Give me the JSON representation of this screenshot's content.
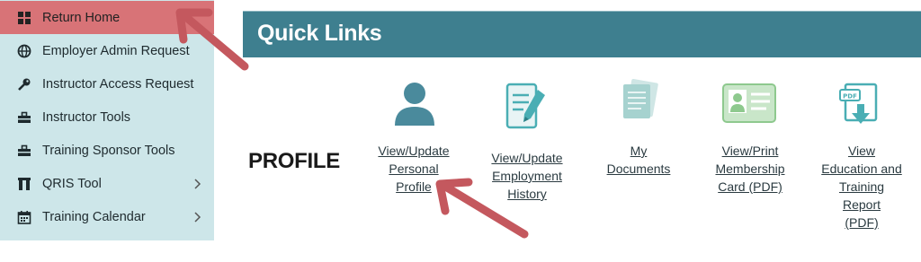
{
  "sidebar": {
    "items": [
      {
        "label": "Return Home",
        "icon": "grid-icon",
        "active": true
      },
      {
        "label": "Employer Admin Request",
        "icon": "globe-icon"
      },
      {
        "label": "Instructor Access Request",
        "icon": "key-icon"
      },
      {
        "label": "Instructor Tools",
        "icon": "toolbox-icon"
      },
      {
        "label": "Training Sponsor Tools",
        "icon": "toolbox-icon"
      },
      {
        "label": "QRIS Tool",
        "icon": "archway-icon",
        "chevron": true
      },
      {
        "label": "Training Calendar",
        "icon": "calendar-icon",
        "chevron": true
      }
    ]
  },
  "main": {
    "title": "Quick Links",
    "section_label": "PROFILE",
    "links": [
      {
        "lines": [
          "View/Update",
          "Personal",
          "Profile"
        ],
        "icon": "user-icon"
      },
      {
        "lines": [
          "View/Update",
          "Employment",
          "History"
        ],
        "icon": "document-edit-icon"
      },
      {
        "lines": [
          "My",
          "Documents"
        ],
        "icon": "documents-icon"
      },
      {
        "lines": [
          "View/Print",
          "Membership",
          "Card (PDF)"
        ],
        "icon": "id-card-icon"
      },
      {
        "lines": [
          "View",
          "Education and",
          "Training",
          "Report",
          "(PDF)"
        ],
        "icon": "pdf-download-icon"
      }
    ]
  },
  "colors": {
    "sidebar_bg": "#cde6e9",
    "active_item": "#d87377",
    "banner": "#3e7f8f",
    "arrow": "#c4585e"
  }
}
